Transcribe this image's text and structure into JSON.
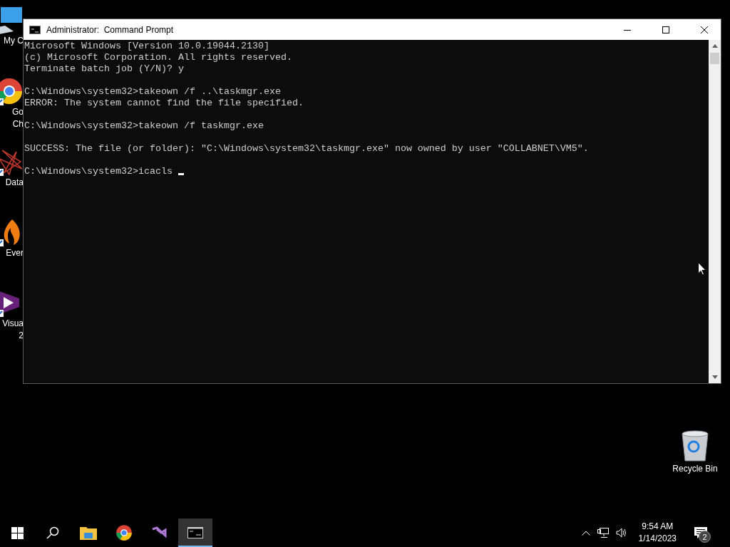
{
  "desktop_icons": [
    {
      "kind": "computer",
      "label_lines": [
        "My C"
      ]
    },
    {
      "kind": "browser",
      "label_lines": [
        "Go",
        "Ch"
      ]
    },
    {
      "kind": "graph",
      "label_lines": [
        "Data"
      ]
    },
    {
      "kind": "flame",
      "label_lines": [
        "Ever"
      ]
    },
    {
      "kind": "studio",
      "label_lines": [
        "Visua",
        "2"
      ]
    },
    {
      "kind": "recycle",
      "label_lines": [
        "Recycle Bin"
      ]
    }
  ],
  "window": {
    "title": "Administrator:  Command Prompt",
    "console": {
      "blocks": [
        [
          "Microsoft Windows [Version 10.0.19044.2130]",
          "(c) Microsoft Corporation. All rights reserved.",
          "Terminate batch job (Y/N)? y"
        ],
        [
          "C:\\Windows\\system32>takeown /f ..\\taskmgr.exe",
          "ERROR: The system cannot find the file specified."
        ],
        [
          "C:\\Windows\\system32>takeown /f taskmgr.exe"
        ],
        [
          "SUCCESS: The file (or folder): \"C:\\Windows\\system32\\taskmgr.exe\" now owned by user \"COLLABNET\\VM5\"."
        ]
      ],
      "input_line": "C:\\Windows\\system32>icacls ",
      "cursor": true
    }
  },
  "taskbar": {
    "apps": [
      {
        "kind": "start",
        "selected": false
      },
      {
        "kind": "search",
        "selected": false
      },
      {
        "kind": "folder",
        "selected": false
      },
      {
        "kind": "browser",
        "selected": false
      },
      {
        "kind": "studio",
        "selected": false
      },
      {
        "kind": "console",
        "selected": true
      }
    ],
    "time": "9:54 AM",
    "date": "1/14/2023",
    "notification_count": "2"
  }
}
